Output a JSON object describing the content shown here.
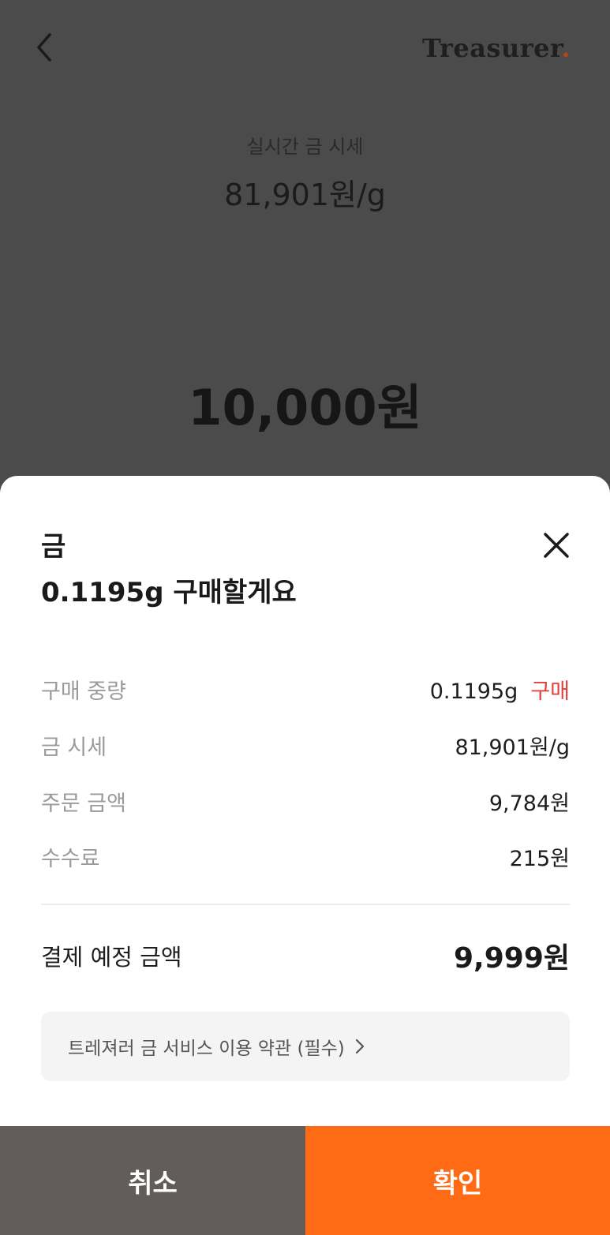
{
  "header": {
    "logo_text": "Treasurer",
    "logo_dot": "."
  },
  "price": {
    "label": "실시간 금 시세",
    "value": "81,901원/g"
  },
  "amount": "10,000원",
  "sheet": {
    "title_line1": "금",
    "title_line2": "0.1195g 구매할게요",
    "rows": [
      {
        "label": "구매 중량",
        "value": "0.1195g",
        "tag": "구매"
      },
      {
        "label": "금 시세",
        "value": "81,901원/g"
      },
      {
        "label": "주문 금액",
        "value": "9,784원"
      },
      {
        "label": "수수료",
        "value": "215원"
      }
    ],
    "total": {
      "label": "결제 예정 금액",
      "value": "9,999원"
    },
    "terms_text": "트레져러 금 서비스 이용 약관 (필수)"
  },
  "buttons": {
    "cancel": "취소",
    "confirm": "확인"
  },
  "colors": {
    "accent": "#ff6a14",
    "cancel_bg": "#625d5a",
    "tag_red": "#e0413a",
    "overlay": "#4b4b4b"
  },
  "icons": [
    "chevron-left-icon",
    "close-icon",
    "chevron-right-icon"
  ]
}
